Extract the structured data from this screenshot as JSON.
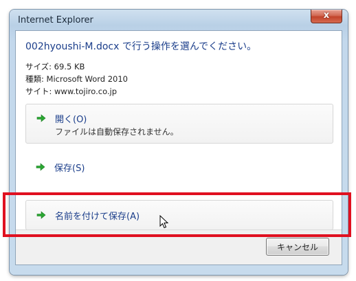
{
  "window": {
    "title": "Internet Explorer",
    "close_glyph": "x"
  },
  "dialog": {
    "heading": "002hyoushi-M.docx で行う操作を選んでください。",
    "size_line": "サイズ: 69.5 KB",
    "type_line": "種類: Microsoft Word 2010",
    "site_line": "サイト: www.tojiro.co.jp"
  },
  "commands": [
    {
      "label": "開く(O)",
      "subtext": "ファイルは自動保存されません。",
      "icon": "green-arrow-icon"
    },
    {
      "label": "保存(S)",
      "icon": "green-arrow-icon"
    },
    {
      "label": "名前を付けて保存(A)",
      "icon": "green-arrow-icon"
    }
  ],
  "footer": {
    "cancel_label": "キャンセル"
  },
  "colors": {
    "arrow": "#2aa832",
    "highlight": "#e01020",
    "link_text": "#1a3d8a"
  }
}
